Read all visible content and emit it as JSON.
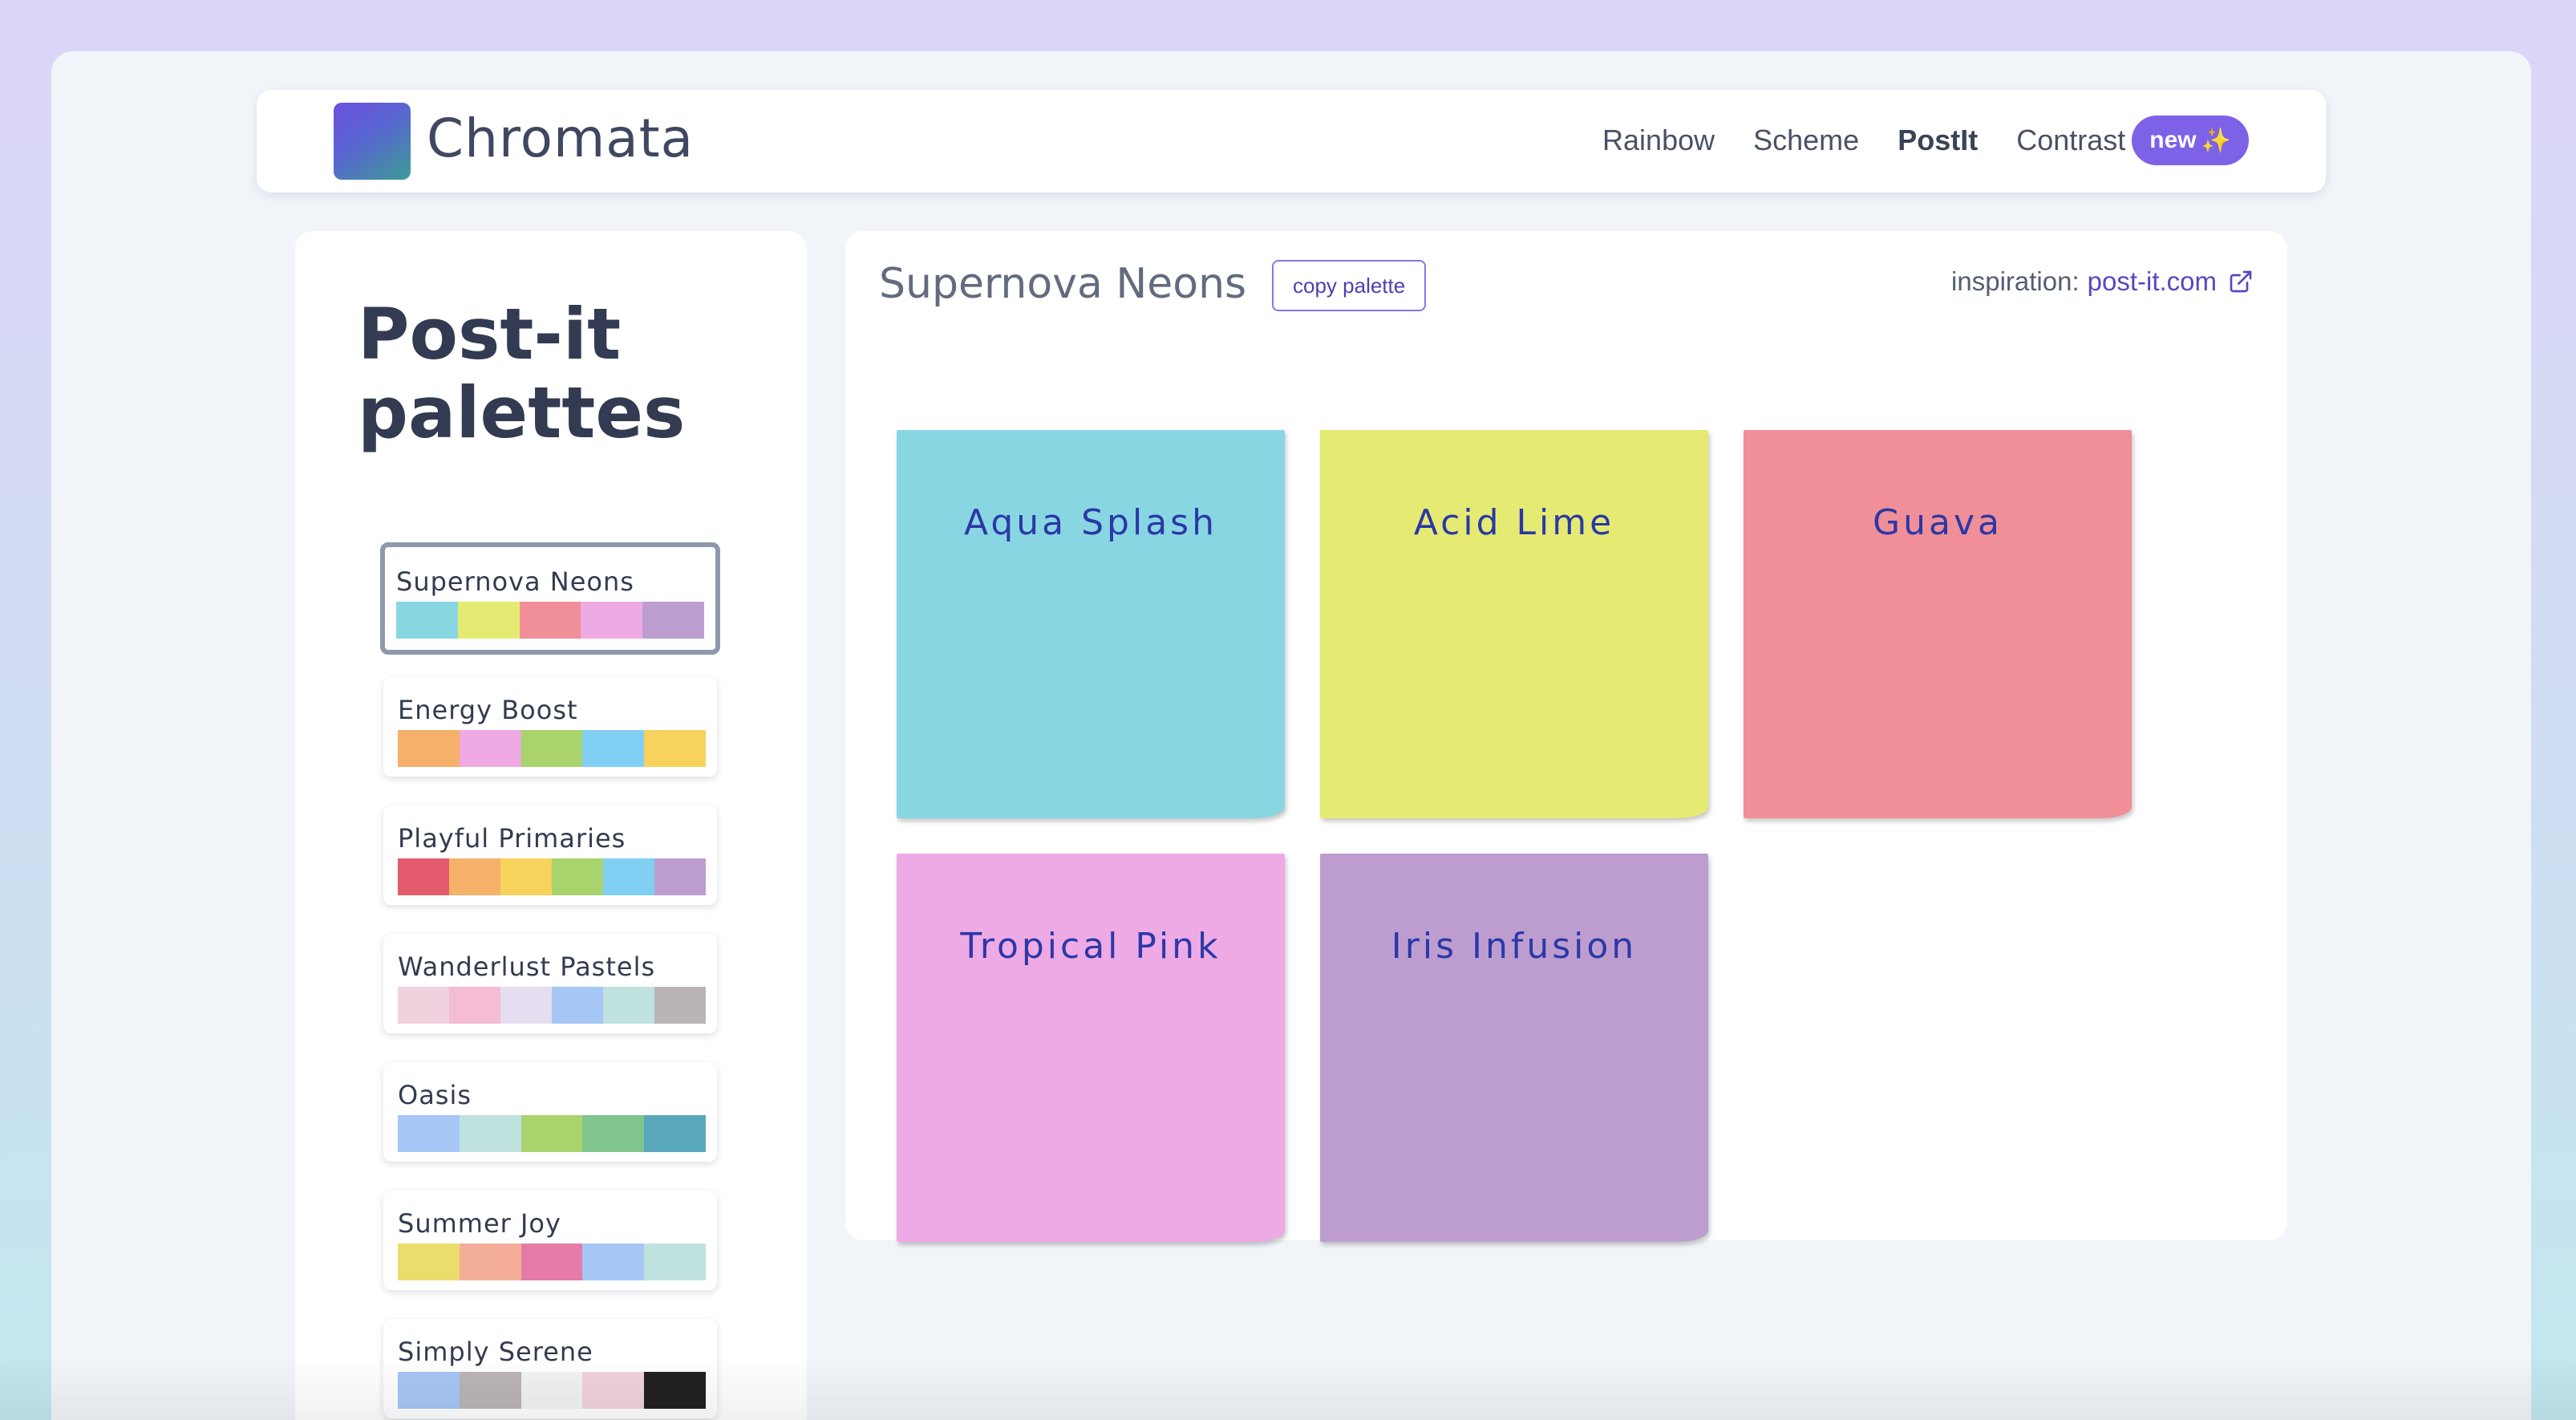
{
  "header": {
    "brand": "Chromata",
    "nav": [
      {
        "label": "Rainbow"
      },
      {
        "label": "Scheme"
      },
      {
        "label": "PostIt"
      },
      {
        "label": "Contrast"
      }
    ],
    "active_nav": "PostIt",
    "badge": {
      "label": "new",
      "icon": "sparkles-icon",
      "glyph": "✨"
    }
  },
  "sidebar": {
    "title": "Post-it palettes",
    "selected": "Supernova Neons",
    "palettes": [
      {
        "name": "Supernova Neons",
        "colors": [
          "#89d6e3",
          "#e5eb72",
          "#f08f98",
          "#eeaae5",
          "#bd9dd0"
        ]
      },
      {
        "name": "Energy Boost",
        "colors": [
          "#f5b06a",
          "#efa9e3",
          "#a9d36c",
          "#82cff4",
          "#f7d25c"
        ]
      },
      {
        "name": "Playful Primaries",
        "colors": [
          "#e45b6d",
          "#f5b06a",
          "#f7d25c",
          "#a9d36c",
          "#82cff4",
          "#bd9dd0"
        ]
      },
      {
        "name": "Wanderlust Pastels",
        "colors": [
          "#efd2dd",
          "#f4bcd5",
          "#e4def0",
          "#a6c6f5",
          "#bfe2df",
          "#bbb4b5"
        ]
      },
      {
        "name": "Oasis",
        "colors": [
          "#a6c6f5",
          "#bfe2df",
          "#a9d36c",
          "#7fc58d",
          "#5aa8bb"
        ]
      },
      {
        "name": "Summer Joy",
        "colors": [
          "#ebdd6b",
          "#f4ad98",
          "#e57ba6",
          "#a6c6f5",
          "#bfe2df"
        ]
      },
      {
        "name": "Simply Serene",
        "colors": [
          "#a6c6f5",
          "#bbb4b5",
          "#f1f2f4",
          "#efd2dd",
          "#222022"
        ]
      }
    ]
  },
  "main": {
    "title": "Supernova Neons",
    "copy_label": "copy palette",
    "inspiration_label": "inspiration:",
    "inspiration_link": "post-it.com",
    "notes": [
      {
        "name": "Aqua Splash",
        "color": "#89d6e3"
      },
      {
        "name": "Acid Lime",
        "color": "#e5eb72"
      },
      {
        "name": "Guava",
        "color": "#f08f98"
      },
      {
        "name": "Tropical Pink",
        "color": "#eeaae5"
      },
      {
        "name": "Iris Infusion",
        "color": "#bd9dd0"
      }
    ]
  }
}
